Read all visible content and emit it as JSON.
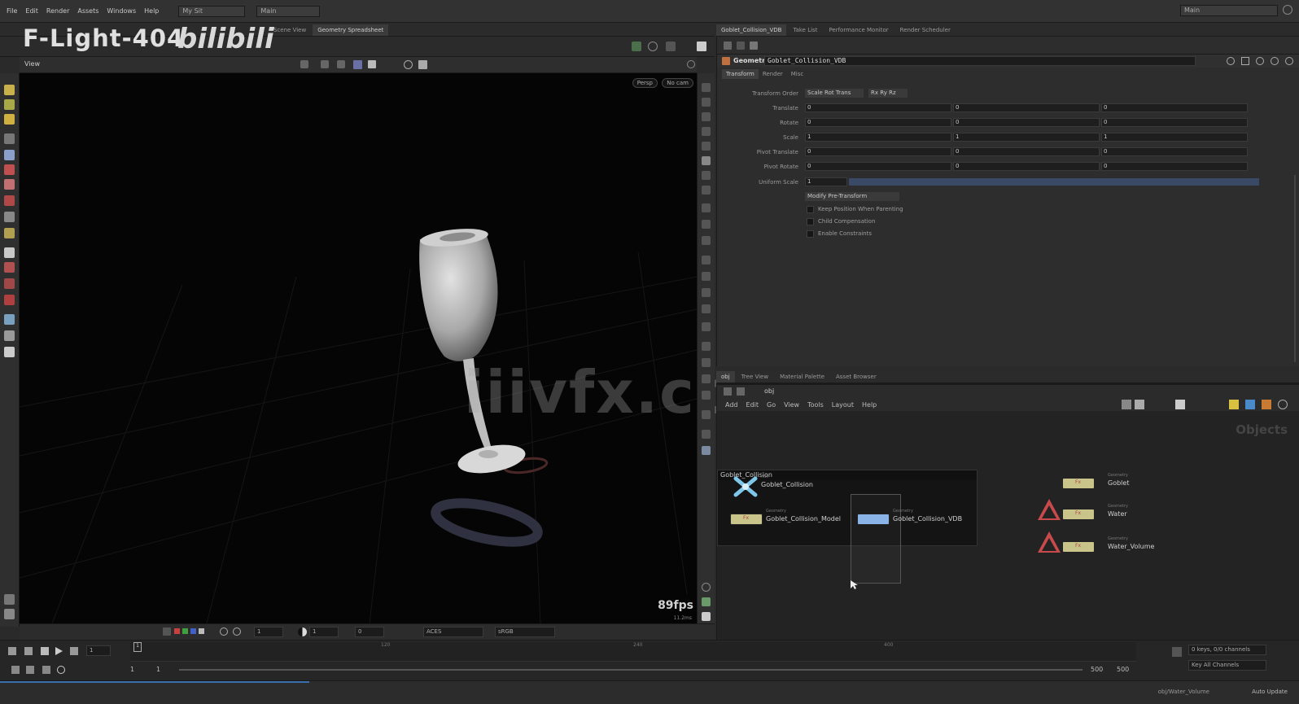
{
  "menubar": {
    "items": [
      "File",
      "Edit",
      "Render",
      "Assets",
      "Windows",
      "Help"
    ],
    "desktop_left": "My Sit",
    "desktop_main": "Main",
    "desktop_right": "Main"
  },
  "overlay": {
    "title": "F-Light-404",
    "logo": "bilibili"
  },
  "watermark": "iiivfx.com",
  "left_tabs": [
    "Scene View",
    "Geometry Spreadsheet"
  ],
  "viewport": {
    "label": "View",
    "persp_button": "Persp",
    "cam_button": "No cam",
    "fps": "89fps",
    "fps_sub": "11.2ms"
  },
  "viewport_bar": {
    "frame_a": "1",
    "frame_b": "1",
    "value_c": "0",
    "colorspace": "ACES",
    "display": "sRGB"
  },
  "param_tabs": [
    "Goblet_Collision_VDB",
    "Take List",
    "Performance Monitor",
    "Render Scheduler"
  ],
  "params": {
    "node_type": "Geometry",
    "node_name": "Goblet_Collision_VDB",
    "tabs": [
      "Transform",
      "Render",
      "Misc"
    ],
    "transform_order_label": "Transform Order",
    "transform_order": "Scale Rot Trans",
    "rot_order": "Rx Ry Rz",
    "rows": [
      {
        "label": "Translate",
        "x": "0",
        "y": "0",
        "z": "0"
      },
      {
        "label": "Rotate",
        "x": "0",
        "y": "0",
        "z": "0"
      },
      {
        "label": "Scale",
        "x": "1",
        "y": "1",
        "z": "1"
      },
      {
        "label": "Pivot Translate",
        "x": "0",
        "y": "0",
        "z": "0"
      },
      {
        "label": "Pivot Rotate",
        "x": "0",
        "y": "0",
        "z": "0"
      }
    ],
    "uniform_scale_label": "Uniform Scale",
    "uniform_scale": "1",
    "pre_transform": "Modify Pre-Transform",
    "checks": [
      "Keep Position When Parenting",
      "Child Compensation",
      "Enable Constraints"
    ]
  },
  "net_tabs": [
    "obj",
    "Tree View",
    "Material Palette",
    "Asset Browser"
  ],
  "net_path": "obj",
  "net_menu": [
    "Add",
    "Edit",
    "Go",
    "View",
    "Tools",
    "Layout",
    "Help"
  ],
  "net_context": "Objects",
  "network": {
    "box_title": "Goblet_Collision",
    "nodes": [
      {
        "name": "Goblet_Collision",
        "type": "null"
      },
      {
        "name": "Goblet_Collision_Model",
        "type": "Geometry"
      },
      {
        "name": "Goblet_Collision_VDB",
        "type": "Geometry"
      },
      {
        "name": "Goblet",
        "type": "Geometry"
      },
      {
        "name": "Water",
        "type": "Geometry"
      },
      {
        "name": "Water_Volume",
        "type": "Geometry"
      }
    ]
  },
  "timeline": {
    "current_frame": "1",
    "start": "1",
    "start2": "1",
    "end": "500",
    "end2": "500",
    "marks": [
      "120",
      "240",
      "400"
    ],
    "keys_info": "0 keys, 0/0 channels",
    "key_all": "Key All Channels"
  },
  "status": {
    "update": "Auto Update",
    "sel": "obj/Water_Volume"
  },
  "colors": {
    "accent": "#3a6fb0",
    "node_geo": "#c9c58a",
    "node_sel": "#8ab4e8",
    "warn": "#c84a4a"
  }
}
